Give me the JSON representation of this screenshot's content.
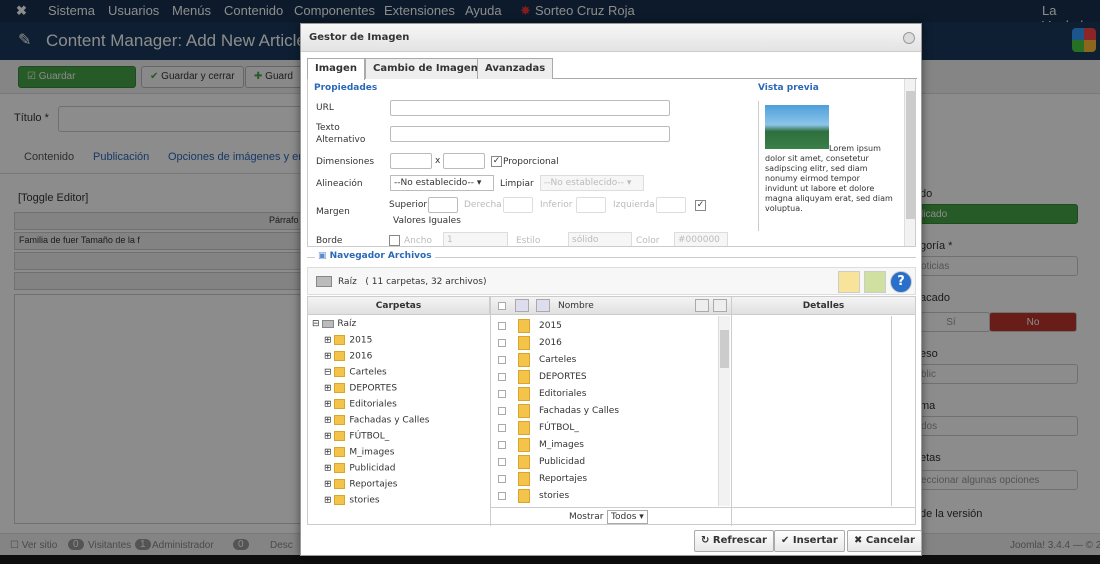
{
  "bg": {
    "menu": [
      "Sistema",
      "Usuarios",
      "Menús",
      "Contenido",
      "Componentes",
      "Extensiones",
      "Ayuda"
    ],
    "site_name": "Sorteo Cruz Roja",
    "user_right": "La Verdad",
    "header_title": "Content Manager: Add New Article",
    "toolbar": {
      "save": "Guardar",
      "save_close": "Guardar y cerrar",
      "save_new": "Guard"
    },
    "title_label": "Título *",
    "tabs": [
      "Contenido",
      "Publicación",
      "Opciones de imágenes y enl"
    ],
    "toggle_editor": "[Toggle Editor]",
    "font_family": "Familia de fuer",
    "font_size": "Tamaño de la f",
    "paragraph": "Párrafo",
    "sidebar": {
      "status_label": "do",
      "status_value": "licado",
      "category_label": "goría *",
      "category_value": "oticias",
      "featured_label": "acado",
      "featured_yes": "Sí",
      "featured_no": "No",
      "access_label": "eso",
      "access_value": "blic",
      "language_label": "ma",
      "language_value": "dos",
      "tags_label": "etas",
      "tags_placeholder": "eccionar algunas opciones",
      "version_note": "de la versión"
    },
    "status": {
      "view_site": "Ver sitio",
      "visitors_count": "0",
      "visitors": "Visitantes",
      "admin_count": "1",
      "admin": "Administrador",
      "msg_count": "0",
      "desc": "Desc",
      "version": "Joomla! 3.4.4 — © 2"
    }
  },
  "dialog": {
    "title": "Gestor de Imagen",
    "tabs": [
      "Imagen",
      "Cambio de Imagen",
      "Avanzadas"
    ],
    "props_title": "Propiedades",
    "url_label": "URL",
    "alt_label_1": "Texto",
    "alt_label_2": "Alternativo",
    "dims_label": "Dimensiones",
    "dims_x": "x",
    "proportional": "Proporcional",
    "align_label": "Alineación",
    "align_value": "--No establecido--",
    "clear_label": "Limpiar",
    "clear_value": "--No establecido--",
    "margin_label": "Margen",
    "margin_top": "Superior",
    "margin_right": "Derecha",
    "margin_bottom": "Inferior",
    "margin_left": "Izquierda",
    "equal_values": "Valores Iguales",
    "border_label": "Borde",
    "border_width": "Ancho",
    "border_width_value": "1",
    "border_style": "Estilo",
    "border_style_value": "sólido",
    "border_color": "Color",
    "border_color_value": "#000000",
    "preview_title": "Vista previa",
    "preview_text": "Lorem ipsum dolor sit amet, consetetur sadipscing elitr, sed diam nonumy eirmod tempor invidunt ut labore et dolore magna aliquyam erat, sed diam voluptua.",
    "browser_title": "Navegador Archivos",
    "path_root": "Raíz",
    "path_count": "( 11 carpetas, 32 archivos)",
    "col_folders": "Carpetas",
    "col_name": "Nombre",
    "col_details": "Detalles",
    "tree_root": "Raíz",
    "tree": [
      "2015",
      "2016",
      "Carteles",
      "DEPORTES",
      "Editoriales",
      "Fachadas y Calles",
      "FÚTBOL_",
      "M_images",
      "Publicidad",
      "Reportajes",
      "stories"
    ],
    "files": [
      "2015",
      "2016",
      "Carteles",
      "DEPORTES",
      "Editoriales",
      "Fachadas y Calles",
      "FÚTBOL_",
      "M_images",
      "Publicidad",
      "Reportajes",
      "stories"
    ],
    "show_label": "Mostrar",
    "show_value": "Todos",
    "btn_refresh": "Refrescar",
    "btn_insert": "Insertar",
    "btn_cancel": "Cancelar"
  }
}
